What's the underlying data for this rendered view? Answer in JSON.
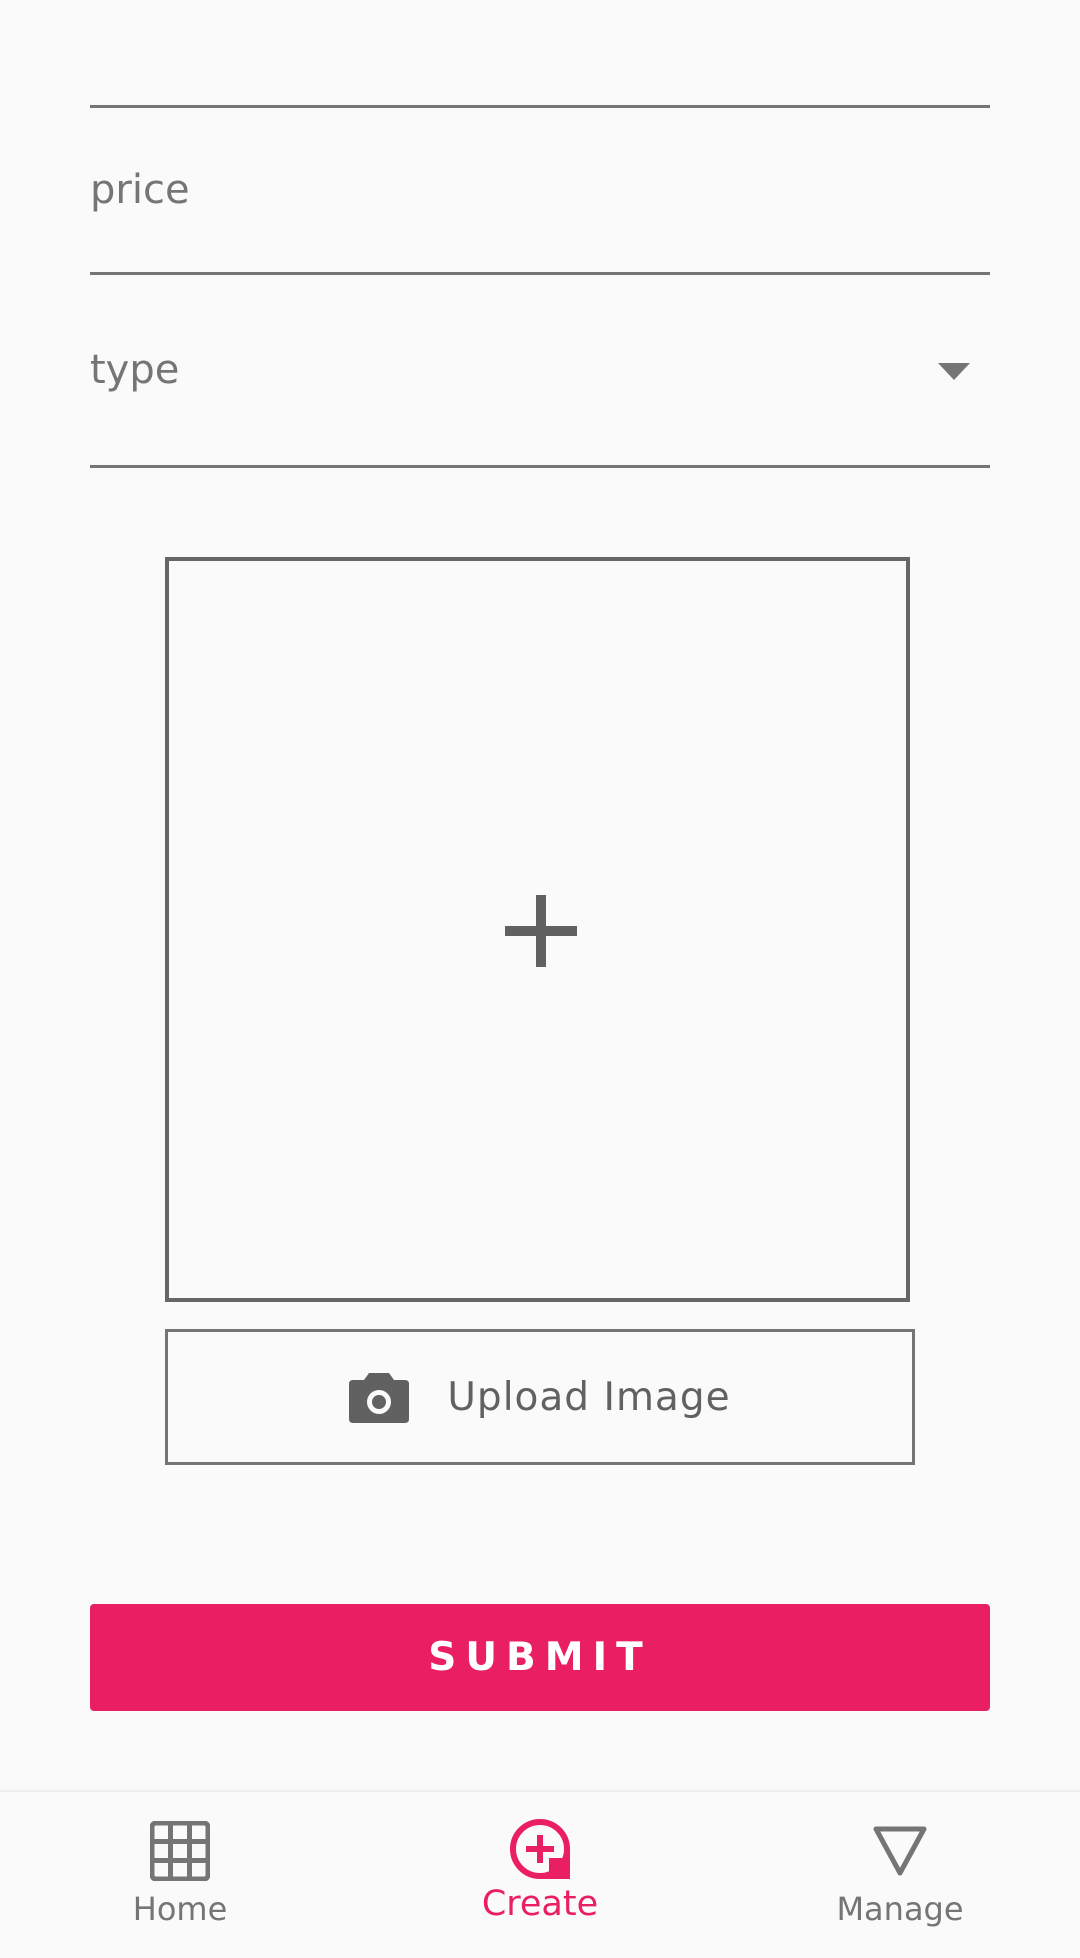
{
  "form": {
    "price_placeholder": "price",
    "type_placeholder": "type",
    "upload_label": "Upload Image",
    "submit_label": "SUBMIT"
  },
  "bottom_nav": {
    "items": [
      {
        "label": "Home",
        "icon": "grid-icon",
        "active": false
      },
      {
        "label": "Create",
        "icon": "add-circle-icon",
        "active": true
      },
      {
        "label": "Manage",
        "icon": "triangle-down-icon",
        "active": false
      }
    ]
  },
  "colors": {
    "accent": "#e91e63",
    "icon_gray": "#616161",
    "text_gray": "#757575",
    "background": "#fafafa"
  }
}
